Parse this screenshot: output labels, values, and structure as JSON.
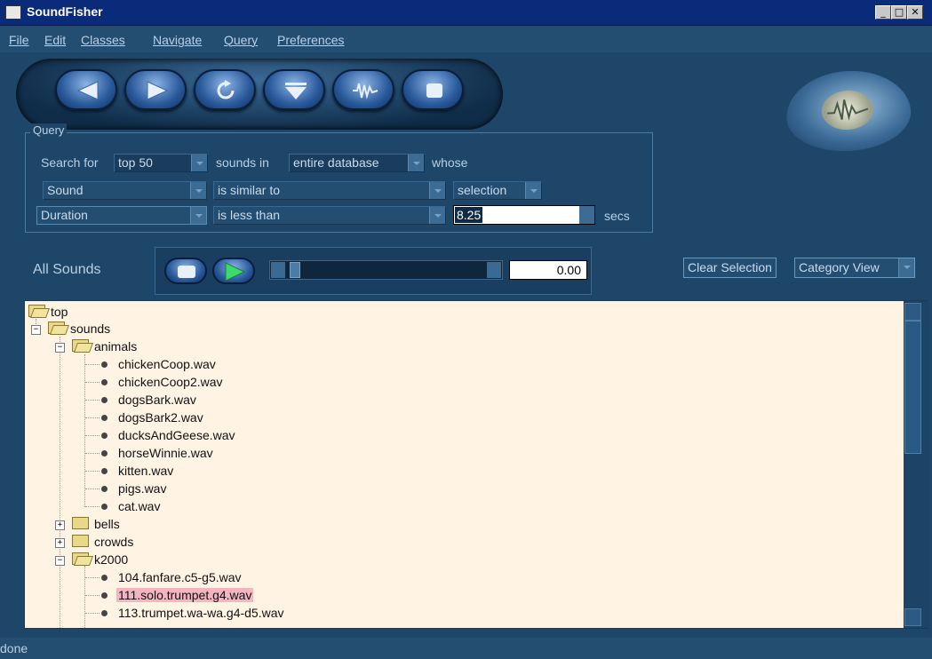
{
  "window": {
    "title": "SoundFisher",
    "minimize": "_",
    "maximize": "□",
    "close": "✕"
  },
  "menu": [
    "File",
    "Edit",
    "Classes",
    "Navigate",
    "Query",
    "Preferences"
  ],
  "toolbar": {
    "buttons": [
      "back-icon",
      "forward-icon",
      "refresh-icon",
      "filter-icon",
      "waveform-icon",
      "stop-icon"
    ]
  },
  "query": {
    "group_label": "Query",
    "row1": {
      "prefix": "Search for",
      "limit": "top 50",
      "mid": "sounds in",
      "scope": "entire database",
      "suffix": "whose"
    },
    "row2": {
      "field": "Sound",
      "op": "is similar to",
      "value": "selection"
    },
    "row3": {
      "field": "Duration",
      "op": "is less than",
      "value": "8.25",
      "unit": "secs"
    }
  },
  "player": {
    "label": "All Sounds",
    "time": "0.00"
  },
  "actions": {
    "clear": "Clear Selection",
    "view": "Category View"
  },
  "tree": {
    "root": "top",
    "sounds": "sounds",
    "animals": "animals",
    "animal_files": [
      "chickenCoop.wav",
      "chickenCoop2.wav",
      "dogsBark.wav",
      "dogsBark2.wav",
      "ducksAndGeese.wav",
      "horseWinnie.wav",
      "kitten.wav",
      "pigs.wav",
      "cat.wav"
    ],
    "bells": "bells",
    "crowds": "crowds",
    "k2000": "k2000",
    "k2000_files": [
      "104.fanfare.c5-g5.wav",
      "111.solo.trumpet.g4.wav",
      "113.trumpet.wa-wa.g4-d5.wav"
    ],
    "selected": "111.solo.trumpet.g4.wav"
  },
  "status": "done"
}
